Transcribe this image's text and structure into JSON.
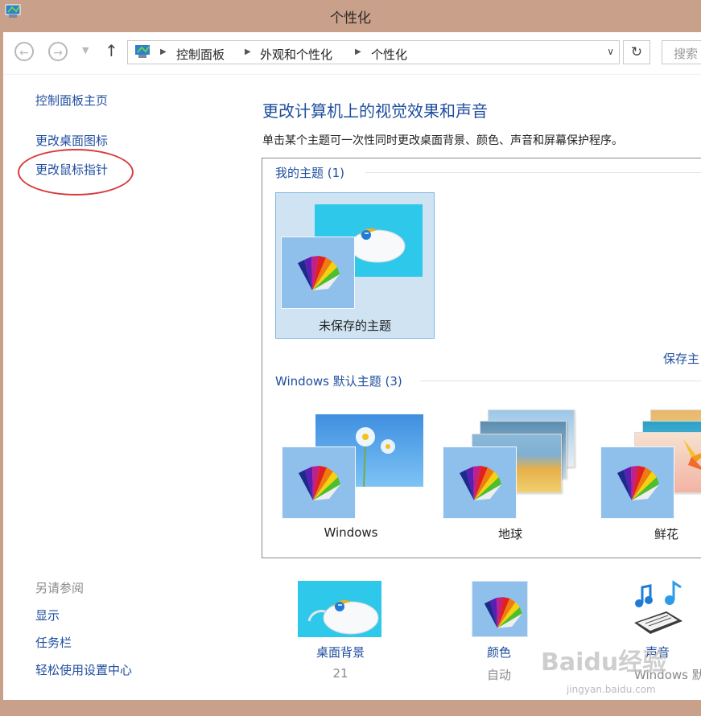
{
  "window": {
    "title": "个性化"
  },
  "nav": {
    "breadcrumbs": [
      "控制面板",
      "外观和个性化",
      "个性化"
    ],
    "search_placeholder": "搜索"
  },
  "left": {
    "links": [
      "控制面板主页",
      "更改桌面图标",
      "更改鼠标指针"
    ],
    "see_also_title": "另请参阅",
    "see_also": [
      "显示",
      "任务栏",
      "轻松使用设置中心"
    ]
  },
  "main": {
    "title": "更改计算机上的视觉效果和声音",
    "desc": "单击某个主题可一次性同时更改桌面背景、颜色、声音和屏幕保护程序。",
    "my_themes_label": "我的主题 (1)",
    "unsaved_theme": "未保存的主题",
    "save_theme_link": "保存主",
    "default_themes_label": "Windows 默认主题 (3)",
    "default_themes": [
      "Windows",
      "地球",
      "鲜花"
    ]
  },
  "tools": {
    "background": {
      "label": "桌面背景",
      "value": "21"
    },
    "color": {
      "label": "颜色",
      "value": "自动"
    },
    "sound": {
      "label": "声音",
      "value": "Windows 默认"
    }
  },
  "watermark": {
    "text": "Baidu经验",
    "sub": "jingyan.baidu.com"
  },
  "colors": {
    "link": "#1f4e9e",
    "selection": "#cfe3f2",
    "accent_cyan": "#2ec8ea",
    "annotation": "#d93a3a"
  }
}
